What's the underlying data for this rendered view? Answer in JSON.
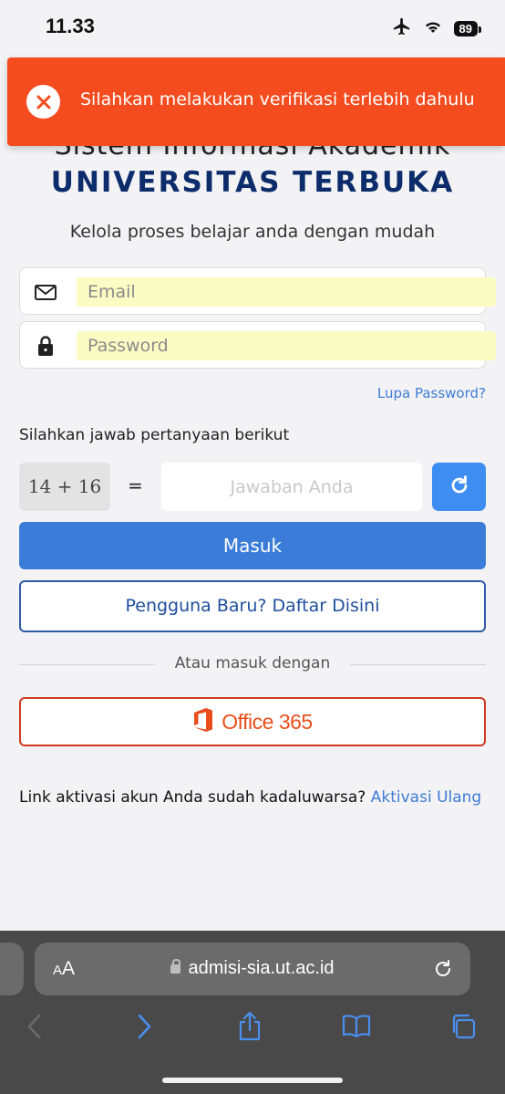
{
  "status_bar": {
    "time": "11.33",
    "battery": "89"
  },
  "toast": {
    "message": "Silahkan melakukan verifikasi terlebih dahulu"
  },
  "header": {
    "title_line1": "Sistem Informasi Akademik",
    "title_line2": "UNIVERSITAS TERBUKA",
    "subtitle": "Kelola proses belajar anda dengan mudah"
  },
  "form": {
    "email_placeholder": "Email",
    "password_placeholder": "Password",
    "forgot_password": "Lupa Password?",
    "captcha_prompt": "Silahkan jawab pertanyaan berikut",
    "captcha_question": "14 + 16",
    "equals": "=",
    "answer_placeholder": "Jawaban Anda",
    "login_button": "Masuk",
    "register_button": "Pengguna Baru? Daftar Disini",
    "divider": "Atau masuk dengan",
    "office_button": "Office 365",
    "activation_text": "Link aktivasi akun Anda sudah kadaluwarsa?",
    "activation_link": "Aktivasi Ulang"
  },
  "browser": {
    "aa_small": "A",
    "aa_large": "A",
    "url": "admisi-sia.ut.ac.id"
  },
  "colors": {
    "toast_bg": "#f44c1f",
    "title_blue": "#0d2c6b",
    "primary_button": "#3b7cd9",
    "link": "#3e7bd6",
    "office_red": "#e84f1c",
    "autofill_yellow": "#fbfcc4"
  }
}
